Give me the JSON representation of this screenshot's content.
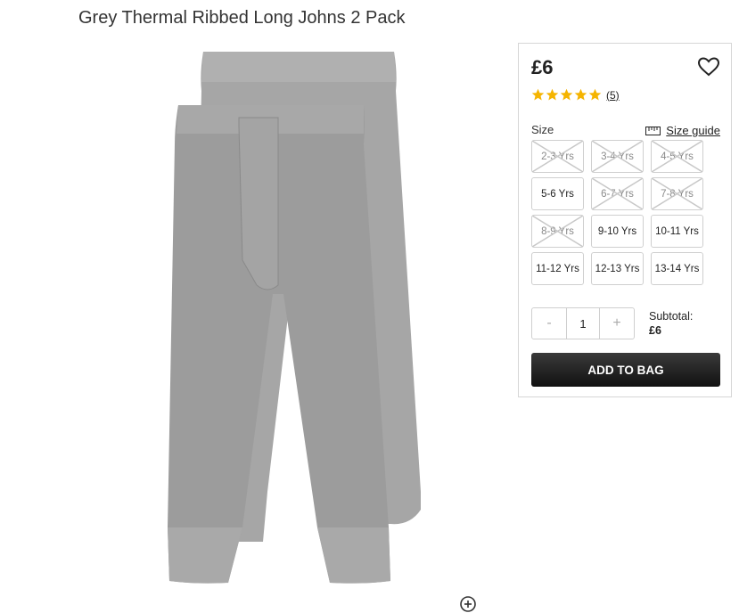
{
  "product": {
    "title": "Grey Thermal Ribbed Long Johns 2 Pack"
  },
  "panel": {
    "price": "£6",
    "rating": {
      "stars": 5,
      "count_label": "(5)"
    },
    "size_label": "Size",
    "size_guide_label": "Size guide",
    "sizes": [
      {
        "label": "2-3 Yrs",
        "available": false
      },
      {
        "label": "3-4 Yrs",
        "available": false
      },
      {
        "label": "4-5 Yrs",
        "available": false
      },
      {
        "label": "5-6 Yrs",
        "available": true
      },
      {
        "label": "6-7 Yrs",
        "available": false
      },
      {
        "label": "7-8 Yrs",
        "available": false
      },
      {
        "label": "8-9 Yrs",
        "available": false
      },
      {
        "label": "9-10 Yrs",
        "available": true
      },
      {
        "label": "10-11 Yrs",
        "available": true
      },
      {
        "label": "11-12 Yrs",
        "available": true
      },
      {
        "label": "12-13 Yrs",
        "available": true
      },
      {
        "label": "13-14 Yrs",
        "available": true
      }
    ],
    "quantity": {
      "minus": "-",
      "value": "1",
      "plus": "+"
    },
    "subtotal_label": "Subtotal:",
    "subtotal_value": "£6",
    "add_to_bag": "ADD TO BAG"
  },
  "colors": {
    "star": "#f5b400",
    "button_dark": "#1a1a1a",
    "fabric": "#9a9a9a"
  },
  "icons": {
    "wishlist": "heart-outline-icon",
    "size_guide": "ruler-icon",
    "zoom": "zoom-in-icon"
  }
}
